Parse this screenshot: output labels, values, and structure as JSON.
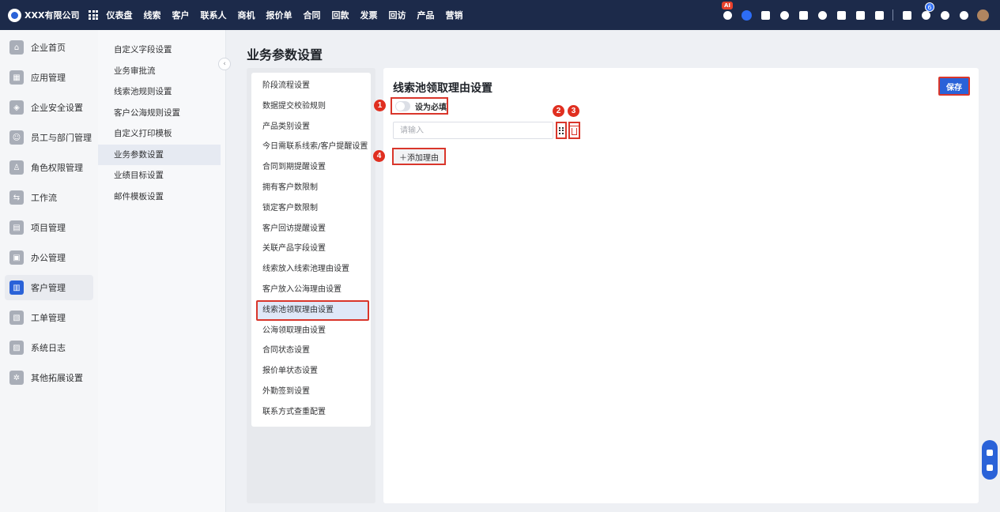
{
  "app": {
    "company": "XXX有限公司",
    "nav": [
      "仪表盘",
      "线索",
      "客户",
      "联系人",
      "商机",
      "报价单",
      "合同",
      "回款",
      "发票",
      "回访",
      "产品",
      "营销"
    ],
    "ai_badge": "AI",
    "notification_count": "6",
    "top_icons": [
      "ai-assistant-icon",
      "chat-icon",
      "message-icon",
      "globe-icon",
      "mail-icon",
      "user-icon",
      "document-icon",
      "phone-icon",
      "calendar-icon",
      "form-icon",
      "bell-icon",
      "help-icon",
      "settings-icon"
    ]
  },
  "sidebar": {
    "items": [
      {
        "label": "企业首页",
        "icon": "home-icon",
        "active": false
      },
      {
        "label": "应用管理",
        "icon": "apps-icon",
        "active": false
      },
      {
        "label": "企业安全设置",
        "icon": "shield-icon",
        "active": false
      },
      {
        "label": "员工与部门管理",
        "icon": "people-icon",
        "active": false
      },
      {
        "label": "角色权限管理",
        "icon": "role-icon",
        "active": false
      },
      {
        "label": "工作流",
        "icon": "workflow-icon",
        "active": false
      },
      {
        "label": "项目管理",
        "icon": "project-icon",
        "active": false
      },
      {
        "label": "办公管理",
        "icon": "office-icon",
        "active": false
      },
      {
        "label": "客户管理",
        "icon": "customer-icon",
        "active": true
      },
      {
        "label": "工单管理",
        "icon": "ticket-icon",
        "active": false
      },
      {
        "label": "系统日志",
        "icon": "log-icon",
        "active": false
      },
      {
        "label": "其他拓展设置",
        "icon": "extension-icon",
        "active": false
      }
    ]
  },
  "submenu": {
    "items": [
      {
        "label": "自定义字段设置",
        "active": false
      },
      {
        "label": "业务审批流",
        "active": false
      },
      {
        "label": "线索池规则设置",
        "active": false
      },
      {
        "label": "客户公海规则设置",
        "active": false
      },
      {
        "label": "自定义打印模板",
        "active": false
      },
      {
        "label": "业务参数设置",
        "active": true
      },
      {
        "label": "业绩目标设置",
        "active": false
      },
      {
        "label": "邮件模板设置",
        "active": false
      }
    ]
  },
  "page": {
    "title": "业务参数设置",
    "settings_list": [
      {
        "label": "阶段流程设置",
        "active": false
      },
      {
        "label": "数据提交校验规则",
        "active": false
      },
      {
        "label": "产品类别设置",
        "active": false
      },
      {
        "label": "今日需联系线索/客户提醒设置",
        "active": false
      },
      {
        "label": "合同到期提醒设置",
        "active": false
      },
      {
        "label": "拥有客户数限制",
        "active": false
      },
      {
        "label": "锁定客户数限制",
        "active": false
      },
      {
        "label": "客户回访提醒设置",
        "active": false
      },
      {
        "label": "关联产品字段设置",
        "active": false
      },
      {
        "label": "线索放入线索池理由设置",
        "active": false
      },
      {
        "label": "客户放入公海理由设置",
        "active": false
      },
      {
        "label": "线索池领取理由设置",
        "active": true
      },
      {
        "label": "公海领取理由设置",
        "active": false
      },
      {
        "label": "合同状态设置",
        "active": false
      },
      {
        "label": "报价单状态设置",
        "active": false
      },
      {
        "label": "外勤签到设置",
        "active": false
      },
      {
        "label": "联系方式查重配置",
        "active": false
      }
    ]
  },
  "panel": {
    "title": "线索池领取理由设置",
    "save_label": "保存",
    "required_toggle_label": "设为必填",
    "required_toggle_on": false,
    "input_value": "",
    "input_placeholder": "请输入",
    "add_reason_label": "＋添加理由"
  },
  "markers": [
    "1",
    "2",
    "3",
    "4"
  ],
  "colors": {
    "topbar": "#1c2a4a",
    "accent": "#2a62d8",
    "highlight": "#d9362b",
    "marker": "#e02f20"
  }
}
